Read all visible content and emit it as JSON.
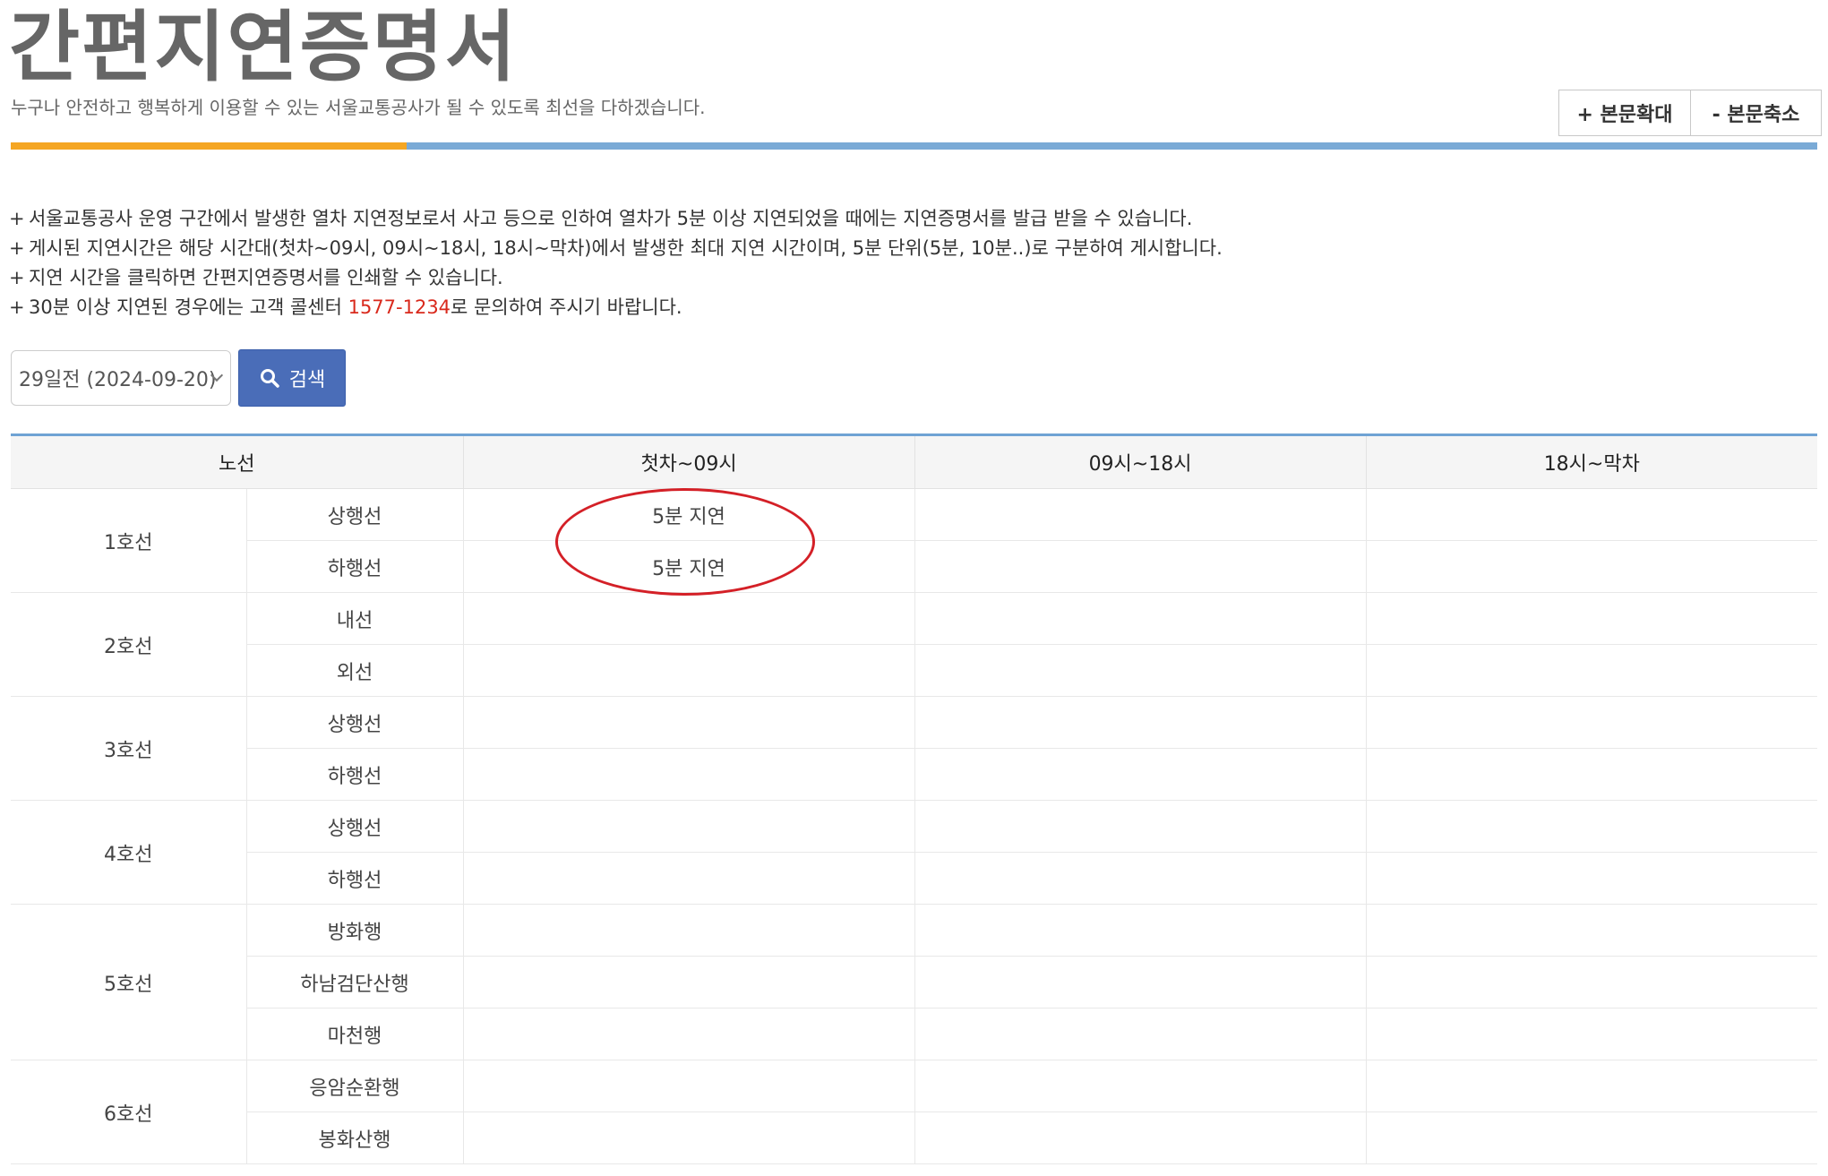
{
  "header": {
    "title": "간편지연증명서",
    "subtitle": "누구나 안전하고 행복하게 이용할 수 있는 서울교통공사가 될 수 있도록 최선을 다하겠습니다.",
    "font_controls": {
      "enlarge_label": "+ 본문확대",
      "shrink_label": "- 본문축소"
    }
  },
  "notices": [
    {
      "bullet": "+",
      "text": "서울교통공사 운영 구간에서 발생한 열차 지연정보로서 사고 등으로 인하여 열차가 5분 이상 지연되었을 때에는 지연증명서를 발급 받을 수 있습니다."
    },
    {
      "bullet": "+",
      "text": "게시된 지연시간은 해당 시간대(첫차~09시, 09시~18시, 18시~막차)에서 발생한 최대 지연 시간이며, 5분 단위(5분, 10분..)로 구분하여 게시합니다."
    },
    {
      "bullet": "+",
      "text": "지연 시간을 클릭하면 간편지연증명서를 인쇄할 수 있습니다."
    },
    {
      "bullet": "+",
      "text_before": "30분 이상 지연된 경우에는 고객 콜센터 ",
      "phone": "1577-1234",
      "text_after": "로 문의하여 주시기 바랍니다."
    }
  ],
  "search": {
    "date_select_value": "29일전 (2024-09-20)",
    "button_label": "검색"
  },
  "table": {
    "headers": [
      "노선",
      "첫차~09시",
      "09시~18시",
      "18시~막차"
    ],
    "groups": [
      {
        "line": "1호선",
        "rows": [
          {
            "direction": "상행선",
            "slot1": "5분 지연",
            "slot2": "",
            "slot3": ""
          },
          {
            "direction": "하행선",
            "slot1": "5분 지연",
            "slot2": "",
            "slot3": ""
          }
        ]
      },
      {
        "line": "2호선",
        "rows": [
          {
            "direction": "내선",
            "slot1": "",
            "slot2": "",
            "slot3": ""
          },
          {
            "direction": "외선",
            "slot1": "",
            "slot2": "",
            "slot3": ""
          }
        ]
      },
      {
        "line": "3호선",
        "rows": [
          {
            "direction": "상행선",
            "slot1": "",
            "slot2": "",
            "slot3": ""
          },
          {
            "direction": "하행선",
            "slot1": "",
            "slot2": "",
            "slot3": ""
          }
        ]
      },
      {
        "line": "4호선",
        "rows": [
          {
            "direction": "상행선",
            "slot1": "",
            "slot2": "",
            "slot3": ""
          },
          {
            "direction": "하행선",
            "slot1": "",
            "slot2": "",
            "slot3": ""
          }
        ]
      },
      {
        "line": "5호선",
        "rows": [
          {
            "direction": "방화행",
            "slot1": "",
            "slot2": "",
            "slot3": ""
          },
          {
            "direction": "하남검단산행",
            "slot1": "",
            "slot2": "",
            "slot3": ""
          },
          {
            "direction": "마천행",
            "slot1": "",
            "slot2": "",
            "slot3": ""
          }
        ]
      },
      {
        "line": "6호선",
        "rows": [
          {
            "direction": "응암순환행",
            "slot1": "",
            "slot2": "",
            "slot3": ""
          },
          {
            "direction": "봉화산행",
            "slot1": "",
            "slot2": "",
            "slot3": ""
          }
        ]
      }
    ]
  },
  "colors": {
    "title_bar_orange": "#f5a623",
    "title_bar_blue": "#7aaad6",
    "search_button_bg": "#4a6db8",
    "phone_red": "#d9291c",
    "annotation_circle": "#d42027"
  }
}
